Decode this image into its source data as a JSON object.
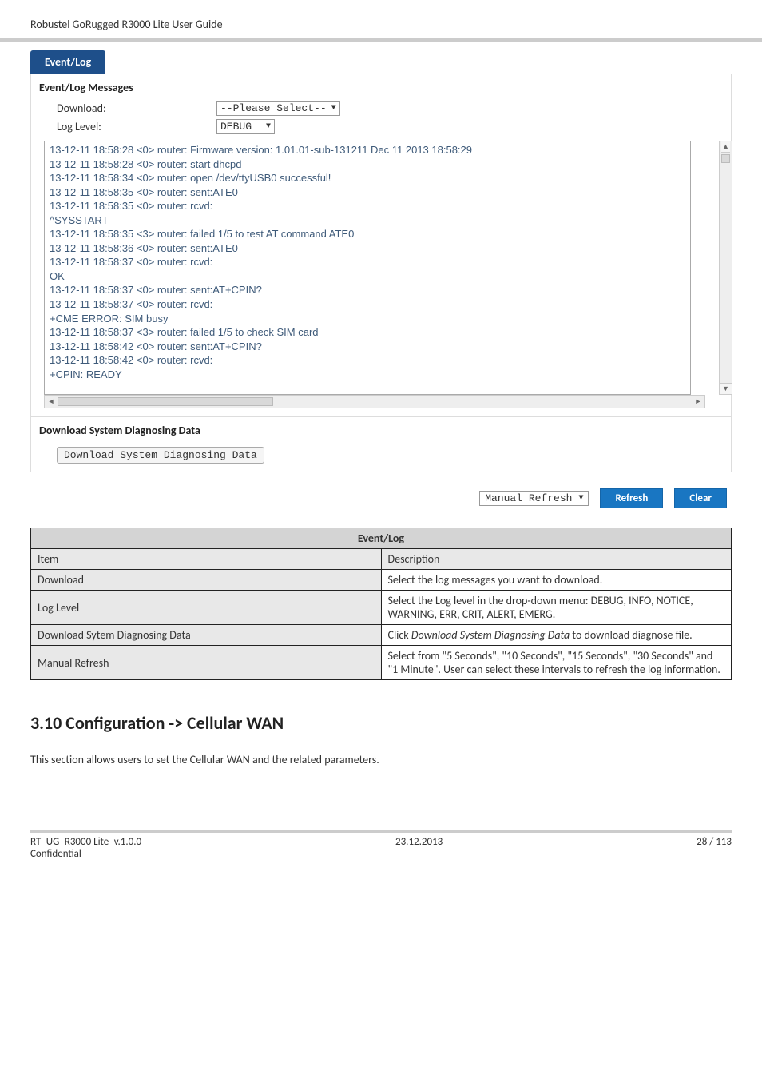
{
  "header": {
    "doc_title": "Robustel GoRugged R3000 Lite User Guide"
  },
  "tab": {
    "label": "Event/Log"
  },
  "panel": {
    "messages_heading": "Event/Log Messages",
    "download_label": "Download:",
    "download_value": "--Please Select--",
    "loglevel_label": "Log Level:",
    "loglevel_value": "DEBUG",
    "log_text": "13-12-11 18:58:28 <0> router: Firmware version: 1.01.01-sub-131211 Dec 11 2013 18:58:29\n13-12-11 18:58:28 <0> router: start dhcpd\n13-12-11 18:58:34 <0> router: open /dev/ttyUSB0 successful!\n13-12-11 18:58:35 <0> router: sent:ATE0\n13-12-11 18:58:35 <0> router: rcvd:\n^SYSSTART\n13-12-11 18:58:35 <3> router: failed 1/5 to test AT command ATE0\n13-12-11 18:58:36 <0> router: sent:ATE0\n13-12-11 18:58:37 <0> router: rcvd:\nOK\n13-12-11 18:58:37 <0> router: sent:AT+CPIN?\n13-12-11 18:58:37 <0> router: rcvd:\n+CME ERROR: SIM busy\n13-12-11 18:58:37 <3> router: failed 1/5 to check SIM card\n13-12-11 18:58:42 <0> router: sent:AT+CPIN?\n13-12-11 18:58:42 <0> router: rcvd:\n+CPIN: READY\n\nOK",
    "diag_heading": "Download System Diagnosing Data",
    "diag_button": "Download System Diagnosing Data"
  },
  "refresh": {
    "dropdown": "Manual Refresh",
    "refresh_btn": "Refresh",
    "clear_btn": "Clear"
  },
  "table": {
    "title": "Event/Log",
    "rows": [
      {
        "c1": "Item",
        "c2": "Description"
      },
      {
        "c1": "Download",
        "c2": "Select the log messages you want to download."
      },
      {
        "c1": "Log Level",
        "c2": "Select the Log level in the drop-down menu: DEBUG, INFO, NOTICE, WARNING, ERR, CRIT, ALERT, EMERG."
      },
      {
        "c1": "Download Sytem Diagnosing Data",
        "c2": "Click Download System Diagnosing Data to download diagnose file.",
        "c2_italic_part": "Download System Diagnosing Data"
      },
      {
        "c1": "Manual Refresh",
        "c2": "Select from \"5 Seconds\", \"10 Seconds\", \"15 Seconds\", \"30 Seconds\" and \"1 Minute\". User can select these intervals to refresh the log information."
      }
    ]
  },
  "section": {
    "heading": "3.10  Configuration -> Cellular WAN",
    "body": "This section allows users to set the Cellular WAN and the related parameters."
  },
  "footer": {
    "left1": "RT_UG_R3000 Lite_v.1.0.0",
    "left2": "Confidential",
    "center": "23.12.2013",
    "right": "28 / 113"
  }
}
